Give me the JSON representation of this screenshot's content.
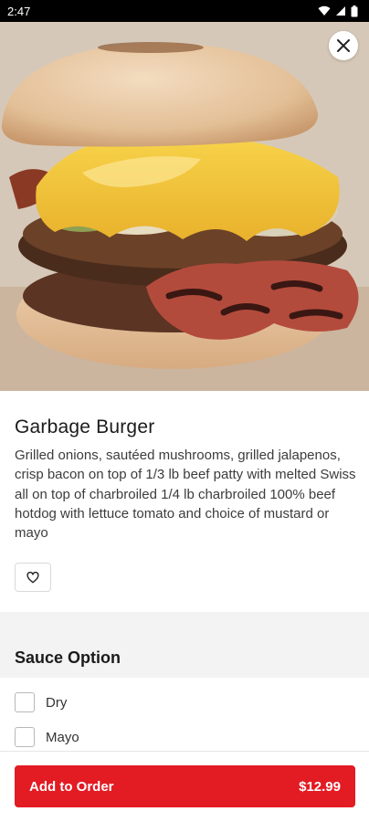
{
  "status_bar": {
    "time": "2:47"
  },
  "item": {
    "title": "Garbage Burger",
    "description": "Grilled onions, sautéed mushrooms, grilled jalapenos, crisp bacon on top of 1/3 lb beef patty with melted Swiss all on top of charbroiled 1/4 lb charbroiled 100% beef hotdog with lettuce tomato and choice of mustard or mayo"
  },
  "sauce": {
    "title": "Sauce Option",
    "options": [
      {
        "label": "Dry",
        "checked": false
      },
      {
        "label": "Mayo",
        "checked": false
      }
    ]
  },
  "cta": {
    "label": "Add to Order",
    "price": "$12.99"
  },
  "colors": {
    "accent": "#e31b23",
    "band": "#f3f3f3"
  },
  "icons": {
    "status": [
      "wifi-icon",
      "signal-icon",
      "battery-icon"
    ],
    "close": "close-icon",
    "favorite": "heart-icon"
  }
}
